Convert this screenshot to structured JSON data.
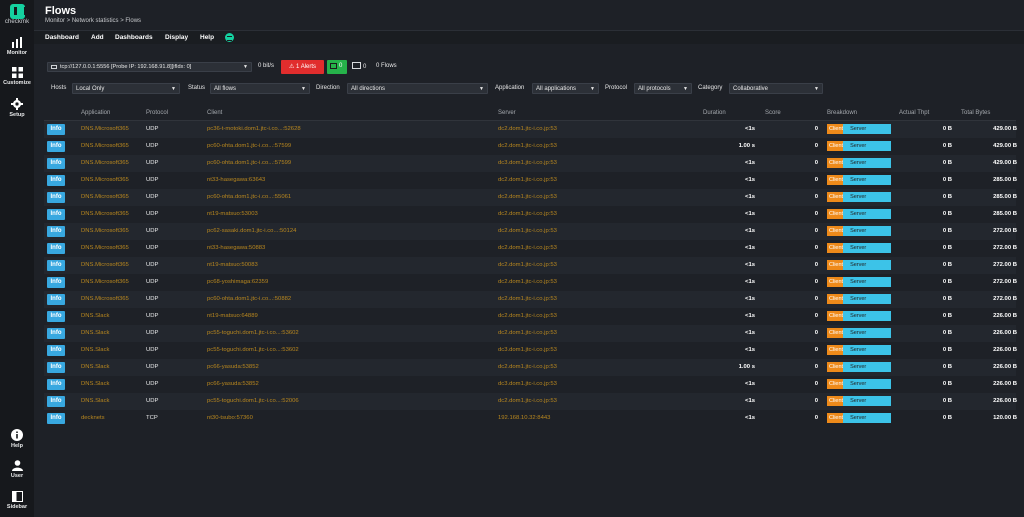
{
  "sidebar": {
    "logo_text": "checkmk",
    "top_items": [
      {
        "label": "Monitor",
        "icon": "bar-chart-icon"
      },
      {
        "label": "Customize",
        "icon": "grid-icon"
      },
      {
        "label": "Setup",
        "icon": "gear-icon"
      }
    ],
    "bottom_items": [
      {
        "label": "Help",
        "icon": "info-icon"
      },
      {
        "label": "User",
        "icon": "user-icon"
      },
      {
        "label": "Sidebar",
        "icon": "sidebar-icon"
      }
    ]
  },
  "header": {
    "title": "Flows",
    "breadcrumb": "Monitor > Network statistics > Flows"
  },
  "menubar": {
    "items": [
      "Dashboard",
      "Add",
      "Dashboards",
      "Display",
      "Help"
    ]
  },
  "toolbar": {
    "interface": "tcp://127.0.0.1:5556 [Probe IP: 192.168.91.8][ifIdx: 0]",
    "throughput": "0 bit/s",
    "alerts": "1 Alerts",
    "hosts_count": "0",
    "devices_count": "0",
    "flows_count": "0 Flows"
  },
  "filters": {
    "hosts_label": "Hosts",
    "hosts_value": "Local Only",
    "status_label": "Status",
    "status_value": "All flows",
    "direction_label": "Direction",
    "direction_value": "All directions",
    "application_label": "Application",
    "application_value": "All applications",
    "protocol_label": "Protocol",
    "protocol_value": "All protocols",
    "category_label": "Category",
    "category_value": "Collaborative"
  },
  "table": {
    "columns": [
      "Application",
      "Protocol",
      "Client",
      "Server",
      "Duration",
      "Score",
      "Breakdown",
      "Actual Thpt",
      "Total Bytes"
    ],
    "info_label": "Info",
    "breakdown_client": "Client",
    "breakdown_server": "Server",
    "rows": [
      {
        "application": "DNS.Microsoft365",
        "protocol": "UDP",
        "client": "pc36-t-motoki.dom1.jtc-i.co...:52628",
        "server": "dc2.dom1.jtc-i.co.jp:53",
        "duration": "<1s",
        "score": "0",
        "thpt": "0 B",
        "bytes": "429.00 B"
      },
      {
        "application": "DNS.Microsoft365",
        "protocol": "UDP",
        "client": "pc60-ohta.dom1.jtc-i.co...:57599",
        "server": "dc2.dom1.jtc-i.co.jp:53",
        "duration": "1.00 s",
        "score": "0",
        "thpt": "0 B",
        "bytes": "429.00 B"
      },
      {
        "application": "DNS.Microsoft365",
        "protocol": "UDP",
        "client": "pc60-ohta.dom1.jtc-i.co...:57599",
        "server": "dc3.dom1.jtc-i.co.jp:53",
        "duration": "<1s",
        "score": "0",
        "thpt": "0 B",
        "bytes": "429.00 B"
      },
      {
        "application": "DNS.Microsoft365",
        "protocol": "UDP",
        "client": "nt33-hasegawa:63643",
        "server": "dc2.dom1.jtc-i.co.jp:53",
        "duration": "<1s",
        "score": "0",
        "thpt": "0 B",
        "bytes": "285.00 B"
      },
      {
        "application": "DNS.Microsoft365",
        "protocol": "UDP",
        "client": "pc60-ohta.dom1.jtc-i.co...:55061",
        "server": "dc2.dom1.jtc-i.co.jp:53",
        "duration": "<1s",
        "score": "0",
        "thpt": "0 B",
        "bytes": "285.00 B"
      },
      {
        "application": "DNS.Microsoft365",
        "protocol": "UDP",
        "client": "nt19-matsuo:53003",
        "server": "dc2.dom1.jtc-i.co.jp:53",
        "duration": "<1s",
        "score": "0",
        "thpt": "0 B",
        "bytes": "285.00 B"
      },
      {
        "application": "DNS.Microsoft365",
        "protocol": "UDP",
        "client": "pc62-sasaki.dom1.jtc-i.co...:50124",
        "server": "dc2.dom1.jtc-i.co.jp:53",
        "duration": "<1s",
        "score": "0",
        "thpt": "0 B",
        "bytes": "272.00 B"
      },
      {
        "application": "DNS.Microsoft365",
        "protocol": "UDP",
        "client": "nt33-hasegawa:50883",
        "server": "dc2.dom1.jtc-i.co.jp:53",
        "duration": "<1s",
        "score": "0",
        "thpt": "0 B",
        "bytes": "272.00 B"
      },
      {
        "application": "DNS.Microsoft365",
        "protocol": "UDP",
        "client": "nt19-matsuo:50083",
        "server": "dc2.dom1.jtc-i.co.jp:53",
        "duration": "<1s",
        "score": "0",
        "thpt": "0 B",
        "bytes": "272.00 B"
      },
      {
        "application": "DNS.Microsoft365",
        "protocol": "UDP",
        "client": "pc68-yoshimaga:62359",
        "server": "dc2.dom1.jtc-i.co.jp:53",
        "duration": "<1s",
        "score": "0",
        "thpt": "0 B",
        "bytes": "272.00 B"
      },
      {
        "application": "DNS.Microsoft365",
        "protocol": "UDP",
        "client": "pc60-ohta.dom1.jtc-i.co...:50882",
        "server": "dc2.dom1.jtc-i.co.jp:53",
        "duration": "<1s",
        "score": "0",
        "thpt": "0 B",
        "bytes": "272.00 B"
      },
      {
        "application": "DNS.Slack",
        "protocol": "UDP",
        "client": "nt19-matsuo:64889",
        "server": "dc2.dom1.jtc-i.co.jp:53",
        "duration": "<1s",
        "score": "0",
        "thpt": "0 B",
        "bytes": "226.00 B"
      },
      {
        "application": "DNS.Slack",
        "protocol": "UDP",
        "client": "pc55-toguchi.dom1.jtc-i.co...:53602",
        "server": "dc2.dom1.jtc-i.co.jp:53",
        "duration": "<1s",
        "score": "0",
        "thpt": "0 B",
        "bytes": "226.00 B"
      },
      {
        "application": "DNS.Slack",
        "protocol": "UDP",
        "client": "pc55-toguchi.dom1.jtc-i.co...:53602",
        "server": "dc3.dom1.jtc-i.co.jp:53",
        "duration": "<1s",
        "score": "0",
        "thpt": "0 B",
        "bytes": "226.00 B"
      },
      {
        "application": "DNS.Slack",
        "protocol": "UDP",
        "client": "pc66-yasuda:53852",
        "server": "dc2.dom1.jtc-i.co.jp:53",
        "duration": "1.00 s",
        "score": "0",
        "thpt": "0 B",
        "bytes": "226.00 B"
      },
      {
        "application": "DNS.Slack",
        "protocol": "UDP",
        "client": "pc66-yasuda:53852",
        "server": "dc3.dom1.jtc-i.co.jp:53",
        "duration": "<1s",
        "score": "0",
        "thpt": "0 B",
        "bytes": "226.00 B"
      },
      {
        "application": "DNS.Slack",
        "protocol": "UDP",
        "client": "pc55-toguchi.dom1.jtc-i.co...:52006",
        "server": "dc2.dom1.jtc-i.co.jp:53",
        "duration": "<1s",
        "score": "0",
        "thpt": "0 B",
        "bytes": "226.00 B"
      },
      {
        "application": "decknets",
        "protocol": "TCP",
        "client": "nt30-tsubo:57360",
        "server": "192.168.10.32:8443",
        "duration": "<1s",
        "score": "0",
        "thpt": "0 B",
        "bytes": "120.00 B"
      }
    ]
  },
  "colors": {
    "accent": "#15d1a0",
    "info_button": "#38a8e0",
    "link": "#b8871f",
    "breakdown_client": "#ee8a1a",
    "breakdown_server": "#3cc3e8",
    "alert": "#e12d2d",
    "hosts_badge": "#26b24a"
  }
}
